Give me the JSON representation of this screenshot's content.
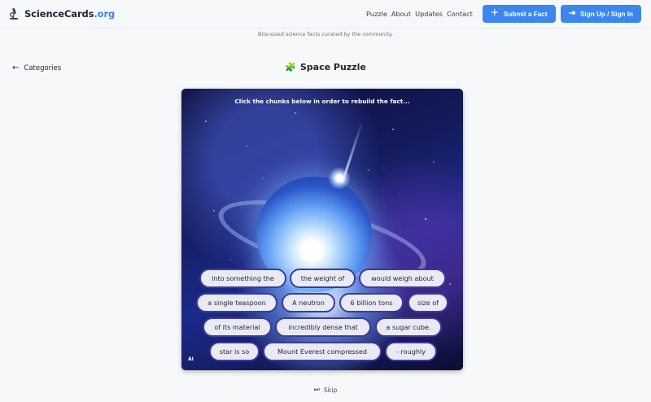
{
  "header": {
    "brand_name": "ScienceCards",
    "brand_tld": ".org",
    "brand_icon": "microscope-icon",
    "nav": [
      "Puzzle",
      "About",
      "Updates",
      "Contact"
    ],
    "submit_label": "Submit a Fact",
    "signin_label": "Sign Up / Sign In",
    "accent_color": "#3b87ef"
  },
  "tagline": "Bite-sized science facts curated by the community.",
  "back_label": "Categories",
  "page_title": "Space Puzzle",
  "card": {
    "instruction": "Click the chunks below in order to rebuild the fact...",
    "ai_label": "AI"
  },
  "chunks": [
    "into something the",
    "the weight of",
    "would weigh about",
    "a single teaspoon",
    "A neutron",
    "6 billion tons",
    "size of",
    "of its material",
    "incredibly dense that",
    "a sugar cube.",
    "star is so",
    "Mount Everest compressed",
    "- roughly"
  ],
  "skip_label": "Skip"
}
